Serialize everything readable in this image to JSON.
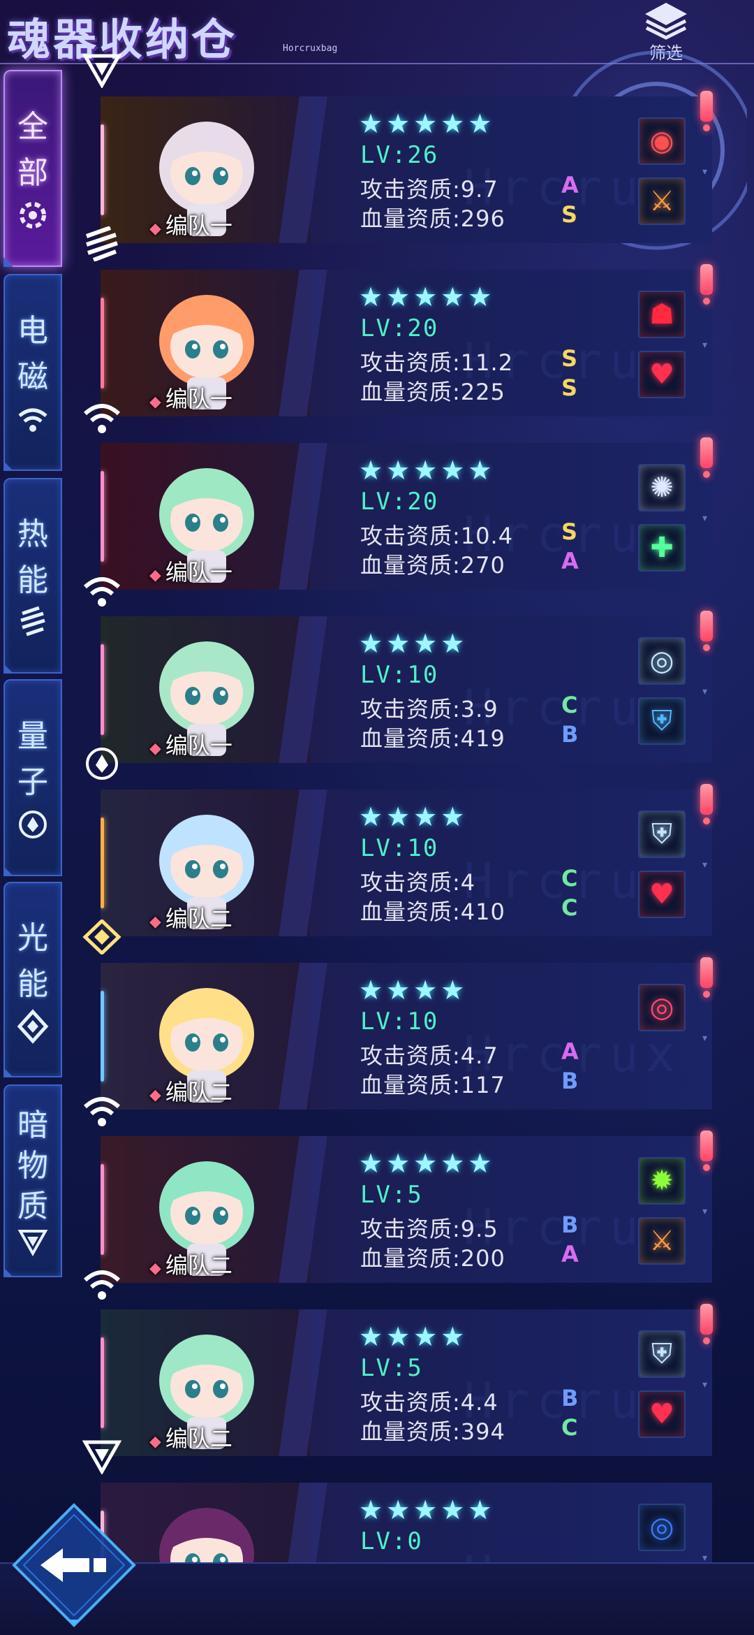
{
  "header": {
    "title": "魂器收纳仓",
    "subtitle": "Horcruxbag",
    "filter_label": "筛选"
  },
  "sidebar": {
    "tabs": [
      {
        "label": "全部",
        "icon": "all-ring-icon",
        "active": true
      },
      {
        "label": "电磁",
        "icon": "wifi-icon",
        "active": false
      },
      {
        "label": "热能",
        "icon": "heat-icon",
        "active": false
      },
      {
        "label": "量子",
        "icon": "quantum-icon",
        "active": false
      },
      {
        "label": "光能",
        "icon": "diamond-icon",
        "active": false
      },
      {
        "label": "暗物质",
        "icon": "dark-triangle-icon",
        "active": false
      }
    ]
  },
  "stat_labels": {
    "atk": "攻击资质:",
    "hp": "血量资质:"
  },
  "cards": [
    {
      "element": "dark-matter",
      "stars": 5,
      "lv": "LV:26",
      "atk": "9.7",
      "atk_grade": "A",
      "hp": "296",
      "hp_grade": "S",
      "team": "编队一",
      "skills": [
        "demon-face-icon",
        "sword-flame-icon"
      ]
    },
    {
      "element": "heat",
      "stars": 5,
      "lv": "LV:20",
      "atk": "11.2",
      "atk_grade": "S",
      "hp": "225",
      "hp_grade": "S",
      "team": "编队一",
      "skills": [
        "red-silhouette-icon",
        "broken-heart-icon"
      ]
    },
    {
      "element": "electromagnetic",
      "stars": 5,
      "lv": "LV:20",
      "atk": "10.4",
      "atk_grade": "S",
      "hp": "270",
      "hp_grade": "A",
      "team": "编队一",
      "skills": [
        "vortex-icon",
        "heal-plus-icon"
      ]
    },
    {
      "element": "electromagnetic",
      "stars": 4,
      "lv": "LV:10",
      "atk": "3.9",
      "atk_grade": "C",
      "hp": "419",
      "hp_grade": "B",
      "team": "编队一",
      "skills": [
        "eye-icon",
        "shield-grid-icon"
      ]
    },
    {
      "element": "quantum",
      "stars": 4,
      "lv": "LV:10",
      "atk": "4",
      "atk_grade": "C",
      "hp": "410",
      "hp_grade": "C",
      "team": "编队二",
      "skills": [
        "shield-wings-icon",
        "broken-heart-icon"
      ]
    },
    {
      "element": "light",
      "stars": 4,
      "lv": "LV:10",
      "atk": "4.7",
      "atk_grade": "A",
      "hp": "117",
      "hp_grade": "B",
      "team": "编队二",
      "skills": [
        "crimson-eye-icon"
      ]
    },
    {
      "element": "electromagnetic",
      "stars": 5,
      "lv": "LV:5",
      "atk": "9.5",
      "atk_grade": "B",
      "hp": "200",
      "hp_grade": "A",
      "team": "编队二",
      "skills": [
        "green-gear-icon",
        "sword-flame-icon"
      ]
    },
    {
      "element": "electromagnetic",
      "stars": 4,
      "lv": "LV:5",
      "atk": "4.4",
      "atk_grade": "B",
      "hp": "394",
      "hp_grade": "C",
      "team": "编队二",
      "skills": [
        "shield-wings-icon",
        "broken-heart-icon"
      ]
    },
    {
      "element": "dark-matter",
      "stars": 5,
      "lv": "LV:0",
      "atk": "",
      "atk_grade": "",
      "hp": "",
      "hp_grade": "",
      "team": "",
      "skills": [
        "blue-ring-icon"
      ]
    }
  ],
  "grade_colors": {
    "S": "#f4d860",
    "A": "#d86cf0",
    "B": "#6f9cff",
    "C": "#72e8a0"
  },
  "element_colors": {
    "dark-matter": "#ffb6d8",
    "heat": "#ff7a9a",
    "electromagnetic": "#ff8fc8",
    "quantum": "#ffb040",
    "light": "#6fc8ff"
  }
}
